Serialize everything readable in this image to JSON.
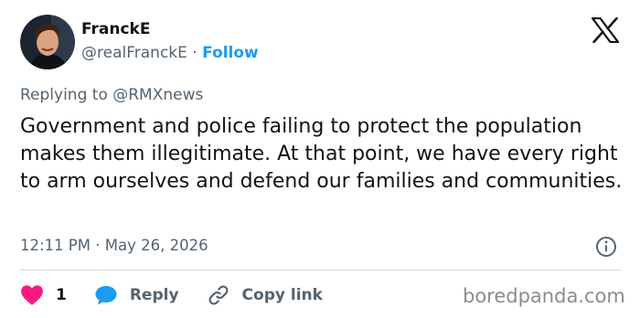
{
  "author": {
    "name": "FranckE",
    "handle": "@realFranckE",
    "separator": "·",
    "follow_label": "Follow"
  },
  "reply_context": "Replying to @RMXnews",
  "tweet_text": "Government and police failing to protect the population makes them illegitimate. At that point, we have every right to arm ourselves and defend our families and communities.",
  "timestamp": {
    "time": "12:11 PM",
    "separator": "·",
    "date": "May 26, 2026"
  },
  "actions": {
    "like_count": "1",
    "reply_label": "Reply",
    "copy_link_label": "Copy link"
  },
  "watermark": "boredpanda.com",
  "colors": {
    "accent": "#1d9bf0",
    "like": "#f91880",
    "muted": "#536471",
    "text": "#0f1419"
  },
  "icons": [
    "x-logo-icon",
    "info-icon",
    "heart-icon",
    "reply-bubble-icon",
    "link-icon"
  ]
}
